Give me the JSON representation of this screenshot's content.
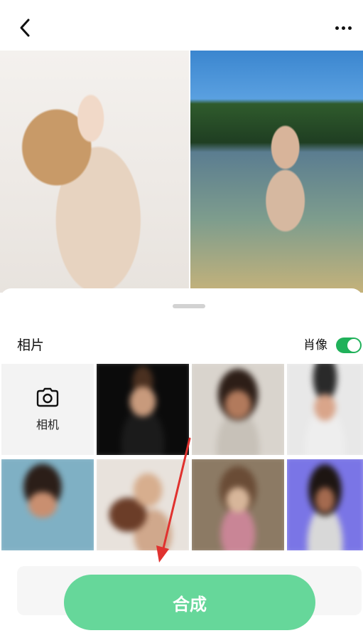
{
  "header": {
    "back_icon": "chevron-left-icon",
    "more_icon": "more-dots-icon"
  },
  "section": {
    "title": "相片"
  },
  "portrait_toggle": {
    "label": "肖像",
    "state": "on",
    "color": "#20b15a"
  },
  "camera_tile": {
    "label": "相机",
    "icon": "camera-icon"
  },
  "compose_button": {
    "label": "合成",
    "color": "#66d79a"
  },
  "annotation": {
    "type": "red-arrow",
    "color": "#e0322f"
  }
}
